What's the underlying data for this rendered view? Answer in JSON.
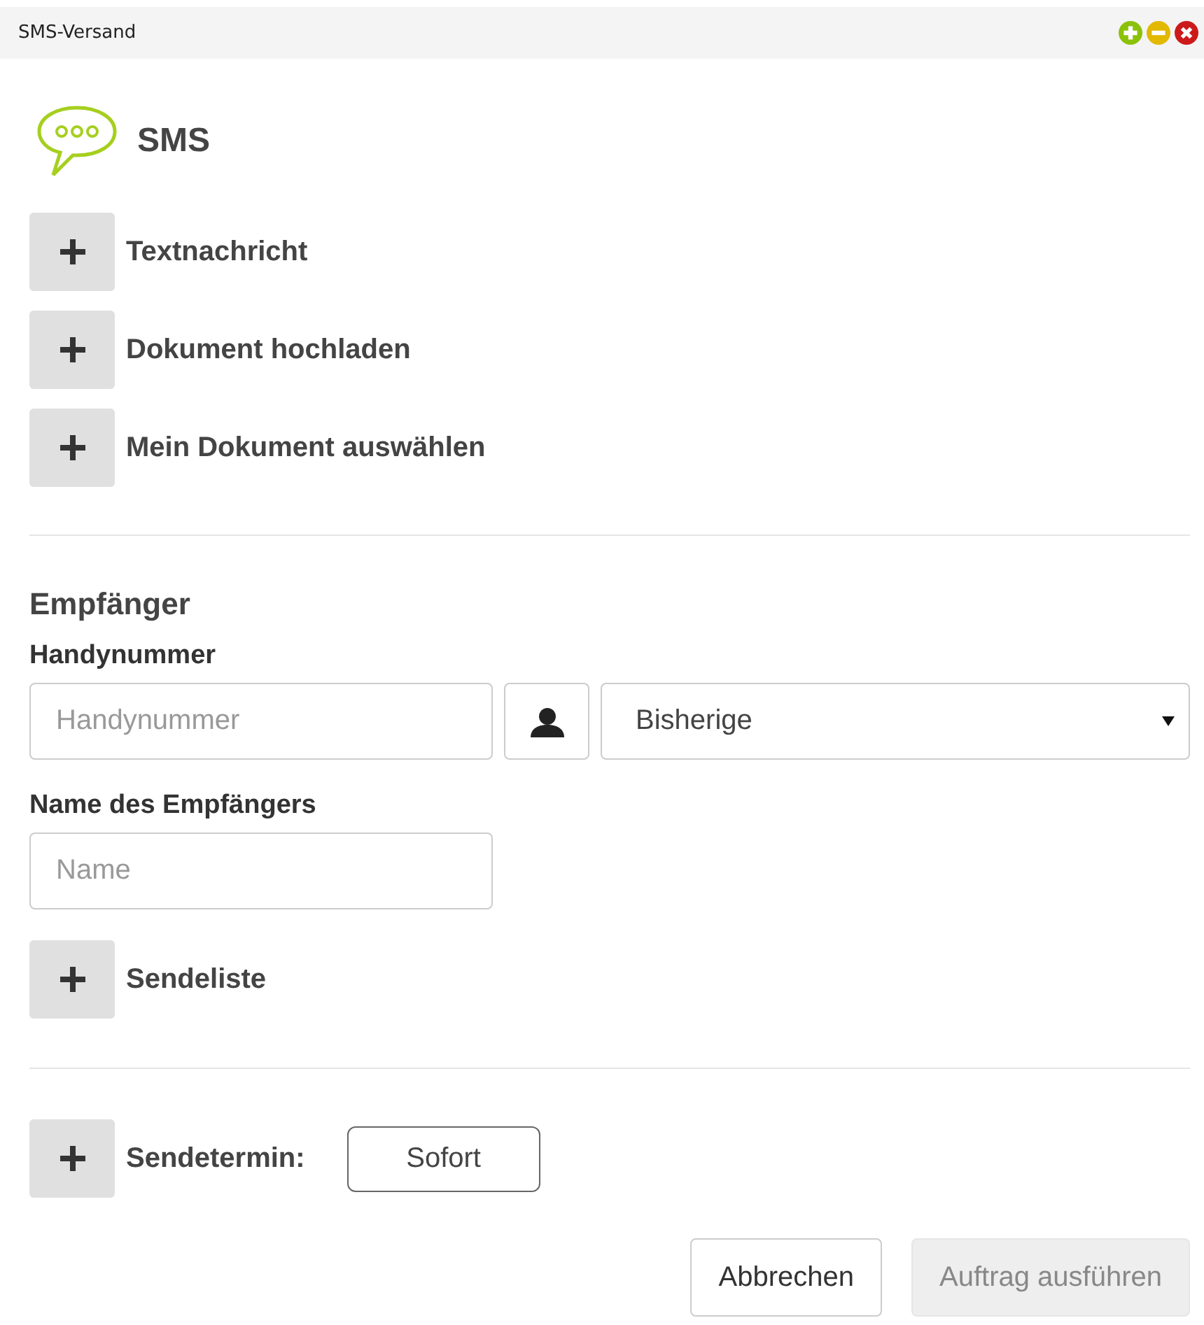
{
  "window": {
    "title": "SMS-Versand"
  },
  "header": {
    "title": "SMS"
  },
  "sections": [
    {
      "label": "Textnachricht",
      "expanded": false
    },
    {
      "label": "Dokument hochladen",
      "expanded": false
    },
    {
      "label": "Mein Dokument auswählen",
      "expanded": false
    }
  ],
  "recipient": {
    "title": "Empfänger",
    "phone_label": "Handynummer",
    "phone_placeholder": "Handynummer",
    "previous_select": "Bisherige",
    "name_label": "Name des Empfängers",
    "name_placeholder": "Name",
    "send_list": {
      "label": "Sendeliste",
      "expanded": false
    }
  },
  "schedule": {
    "label": "Sendetermin:",
    "expanded": false,
    "value": "Sofort"
  },
  "buttons": [
    {
      "label": "Abbrechen",
      "disabled": false
    },
    {
      "label": "Auftrag ausführen",
      "disabled": true
    }
  ]
}
